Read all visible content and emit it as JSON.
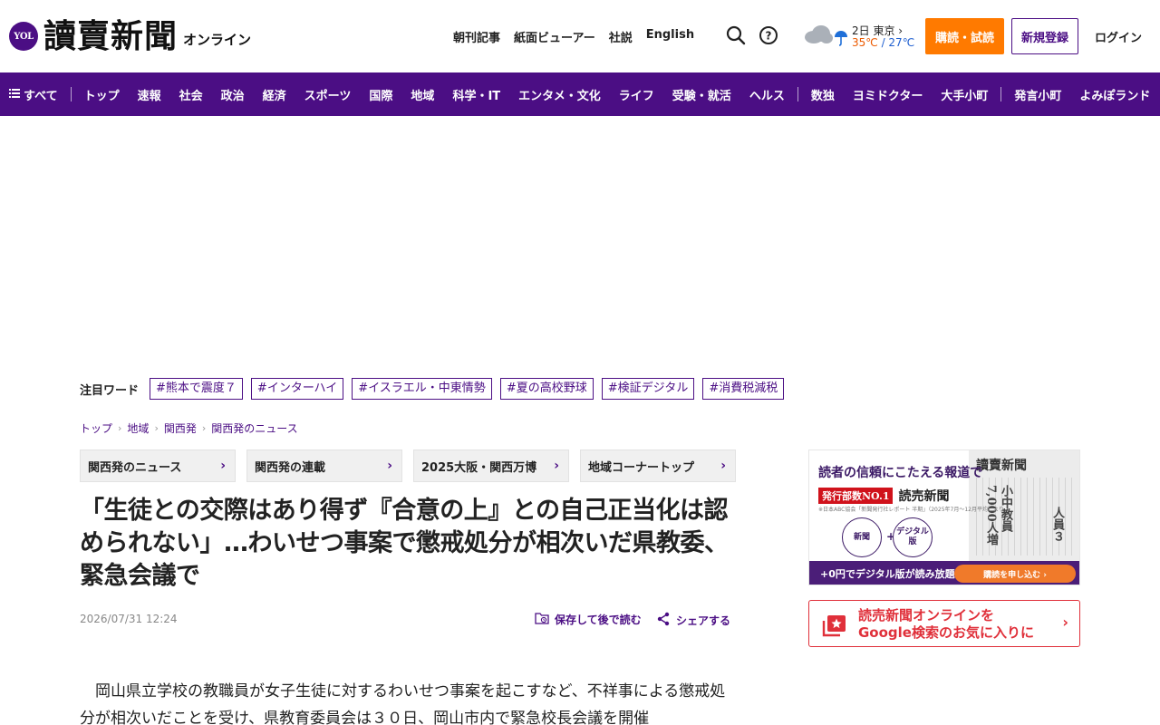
{
  "header": {
    "logo_badge": "YOL",
    "logo_title": "讀賣新聞",
    "logo_sub": "オンライン",
    "links": [
      "朝刊記事",
      "紙面ビューアー",
      "社説",
      "English"
    ],
    "weather": {
      "location": "2日 東京 ›",
      "temp_high": "35℃",
      "temp_sep": " / ",
      "temp_low": "27℃"
    },
    "subscribe_label": "購読・試読",
    "register_label": "新規登録",
    "login_label": "ログイン",
    "colors": {
      "brand": "#4b0e84",
      "subscribe": "#ff7a00"
    }
  },
  "nav": {
    "menu_label": "すべて",
    "group1": [
      "トップ",
      "速報",
      "社会",
      "政治",
      "経済",
      "スポーツ",
      "国際",
      "地域",
      "科学・IT",
      "エンタメ・文化",
      "ライフ",
      "受験・就活",
      "ヘルス"
    ],
    "group2": [
      "数独",
      "ヨミドクター",
      "大手小町"
    ],
    "group3": [
      "発言小町",
      "よみぽランド"
    ]
  },
  "trending": {
    "label": "注目ワード",
    "tags": [
      "#熊本で震度７",
      "#インターハイ",
      "#イスラエル・中東情勢",
      "#夏の高校野球",
      "#検証デジタル",
      "#消費税減税"
    ]
  },
  "breadcrumb": [
    "トップ",
    "地域",
    "関西発",
    "関西発のニュース"
  ],
  "subtabs": [
    "関西発のニュース",
    "関西発の連載",
    "2025大阪・関西万博",
    "地域コーナートップ"
  ],
  "article": {
    "headline": "「生徒との交際はあり得ず『合意の上』との自己正当化は認められない」…わいせつ事案で懲戒処分が相次いだ県教委、緊急会議で",
    "date": "2026/07/31 12:24",
    "save_label": "保存して後で読む",
    "share_label": "シェアする",
    "body": "岡山県立学校の教職員が女子生徒に対するわいせつ事案を起こすなど、不祥事による懲戒処分が相次いだことを受け、県教育委員会は３０日、岡山市内で緊急校長会議を開催"
  },
  "sidebar": {
    "promo": {
      "headline": "読者の信頼にこたえる報道で",
      "rank_badge": "発行部数NO.1",
      "brand": "読売新聞",
      "note": "※日本ABC協会「新聞発行社レポート 半期」（2025年7月〜12月平均）より",
      "circle1": "新聞",
      "circle2": "デジタル版",
      "plus": "+",
      "paper_title": "讀賣新聞",
      "paper_big": "小中教員7,000人増",
      "paper_big2": "人員３",
      "bar_text": "+0円でデジタル版が読み放題!",
      "bar_button": "購読を申し込む ›"
    },
    "google_fav": {
      "line1": "読売新聞オンラインを",
      "line2": "Google検索のお気に入りに"
    }
  }
}
